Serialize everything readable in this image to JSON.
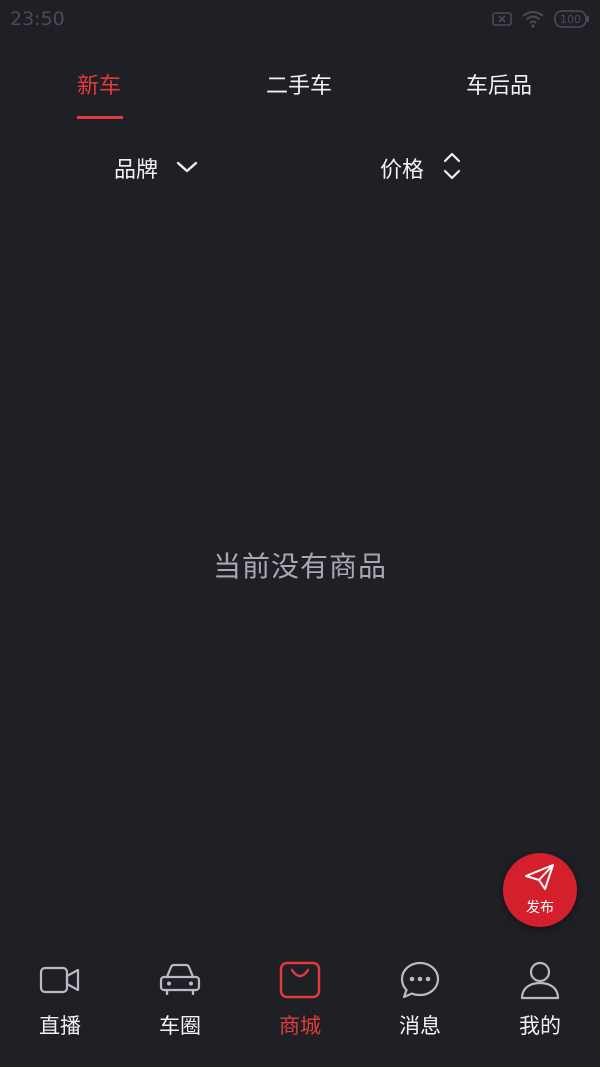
{
  "status_bar": {
    "time": "23:50",
    "battery": "100",
    "icons": [
      "sim-off-icon",
      "wifi-icon",
      "battery-icon"
    ]
  },
  "tabs": [
    {
      "label": "新车",
      "active": true
    },
    {
      "label": "二手车",
      "active": false
    },
    {
      "label": "车后品",
      "active": false
    }
  ],
  "filters": {
    "brand": {
      "label": "品牌",
      "icon": "chevron-down-icon"
    },
    "price": {
      "label": "价格",
      "icon": "sort-updown-icon"
    }
  },
  "main": {
    "empty_message": "当前没有商品"
  },
  "fab": {
    "label": "发布",
    "icon": "send-icon"
  },
  "bottom_nav": [
    {
      "label": "直播",
      "icon": "video-camera-icon",
      "active": false
    },
    {
      "label": "车圈",
      "icon": "car-icon",
      "active": false
    },
    {
      "label": "商城",
      "icon": "shopping-bag-icon",
      "active": true
    },
    {
      "label": "消息",
      "icon": "chat-bubble-icon",
      "active": false
    },
    {
      "label": "我的",
      "icon": "user-icon",
      "active": false
    }
  ],
  "colors": {
    "background": "#1f1f26",
    "accent": "#e23b3b",
    "fab": "#d41f2c",
    "text": "#f2f2f2",
    "muted_text": "#a7a8b0"
  }
}
